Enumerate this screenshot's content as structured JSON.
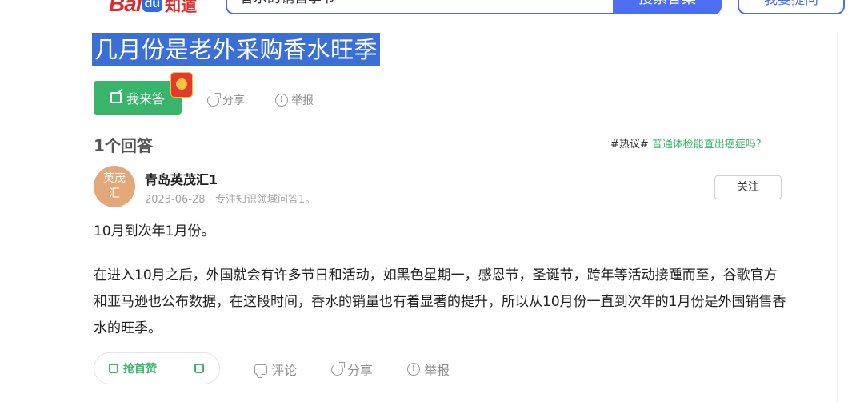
{
  "header": {
    "logo": {
      "bai": "Bai",
      "du": "du",
      "zhidao": "知道"
    },
    "search_value": "香水的销售季节",
    "search_button": "搜索答案",
    "ask_button": "我要提问"
  },
  "question": {
    "title": "几月份是老外采购香水旺季",
    "answer_button": "我来答",
    "share": "分享",
    "report": "举报"
  },
  "answers_header": {
    "count_label": "1个回答",
    "hot_tag": "#热议#",
    "hot_link": "普通体检能查出癌症吗?"
  },
  "answer": {
    "avatar_text": "英茂汇",
    "author": "青岛英茂汇1",
    "meta": "2023-06-28 · 专注知识领域问答1。",
    "follow": "关注",
    "lead": "10月到次年1月份。",
    "body": "在进入10月之后，外国就会有许多节日和活动，如黑色星期一，感恩节，圣诞节，跨年等活动接踵而至，谷歌官方和亚马逊也公布数据，在这段时间，香水的销量也有着显著的提升，所以从10月份一直到次年的1月份是外国销售香水的旺季。",
    "upvote": "抢首赞",
    "comment": "评论",
    "share": "分享",
    "report": "举报"
  },
  "colors": {
    "accent_blue": "#4e6ef2",
    "accent_green": "#38b56a",
    "selection_blue": "#3b6fd4"
  }
}
